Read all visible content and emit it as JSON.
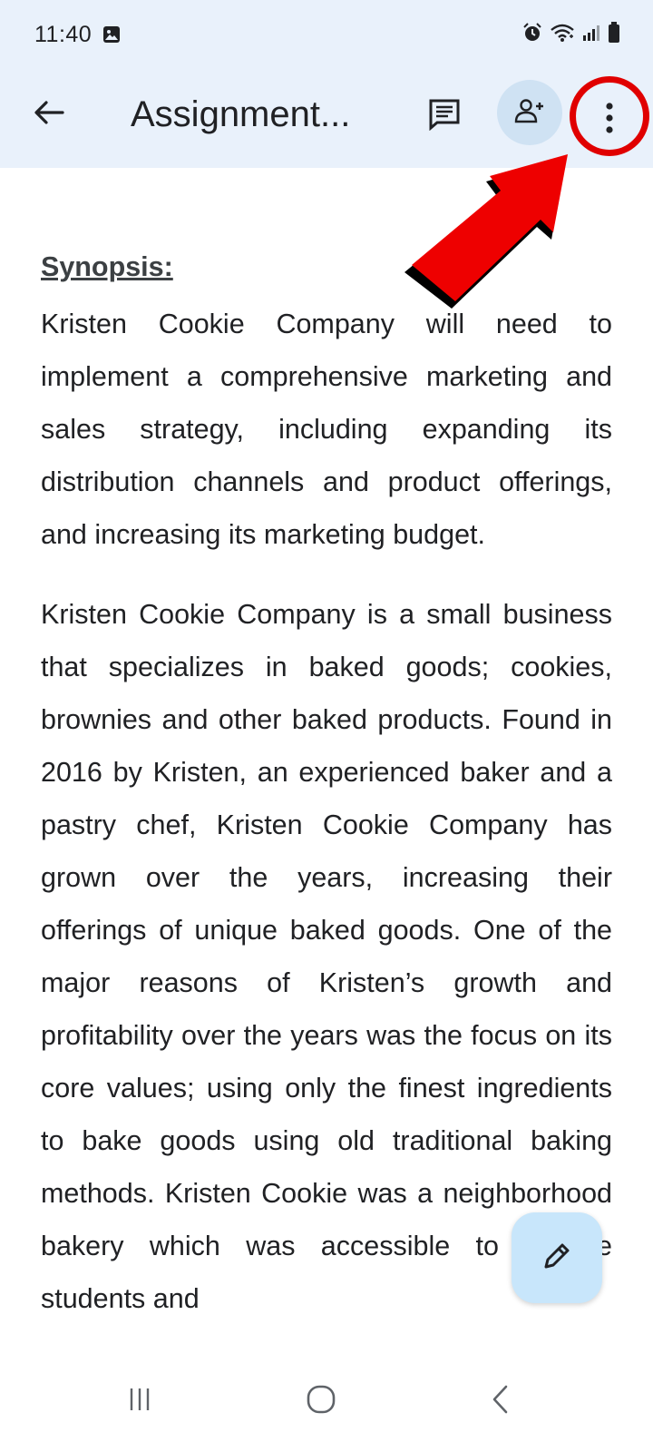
{
  "status_bar": {
    "time": "11:40",
    "icons": [
      "photo-icon",
      "alarm-icon",
      "wifi-icon",
      "signal-icon",
      "battery-icon"
    ]
  },
  "app_bar": {
    "title": "Assignment...",
    "icons": [
      "back-arrow-icon",
      "comment-icon",
      "add-person-icon",
      "more-vert-icon"
    ]
  },
  "document": {
    "heading": "Synopsis:",
    "paragraphs": [
      "Kristen Cookie Company will need to implement a comprehensive marketing and sales strategy, including expanding its distribution channels and product offerings, and increasing its marketing budget.",
      "Kristen Cookie Company is a small business that specializes in baked goods; cookies, brownies and other baked products. Found in 2016 by Kristen, an experienced baker and a pastry chef, Kristen Cookie Company has grown over the years, increasing their offerings of unique baked goods. One of the major reasons of Kristen’s growth and profitability over the years was the focus on its core values; using only the finest ingredients to bake goods using old traditional baking methods. Kristen Cookie was a neighborhood bakery which was accessible to college students and"
    ]
  },
  "fab": {
    "icon": "pencil-icon"
  },
  "colors": {
    "header_bg": "#e9f1fb",
    "share_btn_bg": "#cfe2f3",
    "fab_bg": "#c8e6fb",
    "annotation_red": "#e00000"
  },
  "nav_bar": {
    "icons": [
      "recent-apps-icon",
      "home-icon",
      "back-icon"
    ]
  }
}
